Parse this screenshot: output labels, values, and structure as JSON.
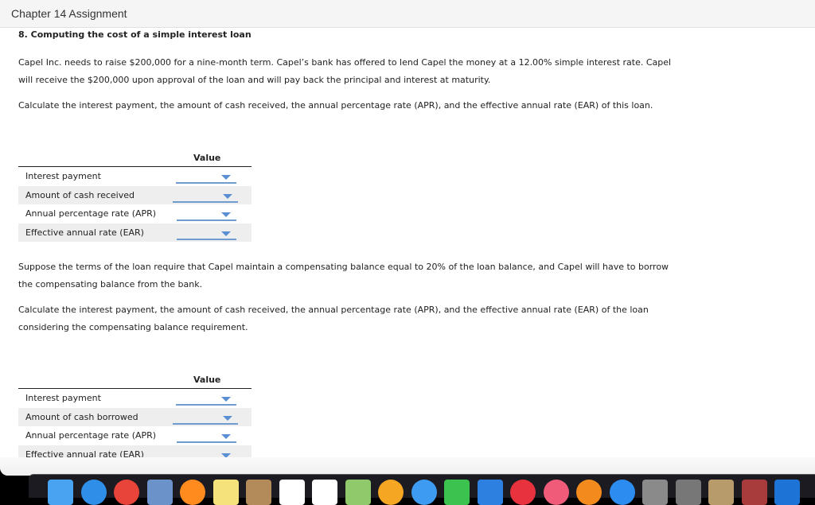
{
  "header": {
    "title": "Chapter 14 Assignment"
  },
  "question": {
    "title": "8. Computing the cost of a simple interest loan",
    "intro_line1": "Capel Inc. needs to raise $200,000 for a nine-month term. Capel’s bank has offered to lend Capel the money at a 12.00% simple interest rate. Capel",
    "intro_line2": "will receive the $200,000 upon approval of the loan and will pay back the principal and interest at maturity.",
    "instruction1": "Calculate the interest payment, the amount of cash received, the annual percentage rate (APR), and the effective annual rate (EAR) of this loan.",
    "scenario_line1": "Suppose the terms of the loan require that Capel maintain a compensating balance equal to 20% of the loan balance, and Capel will have to borrow",
    "scenario_line2": "the compensating balance from the bank.",
    "instruction2_line1": "Calculate the interest payment, the amount of cash received, the annual percentage rate (APR), and the effective annual rate (EAR) of the loan",
    "instruction2_line2": "considering the compensating balance requirement."
  },
  "table1": {
    "header": "Value",
    "rows": [
      {
        "label": "Interest payment",
        "value": ""
      },
      {
        "label": "Amount of cash received",
        "value": ""
      },
      {
        "label": "Annual percentage rate (APR)",
        "value": ""
      },
      {
        "label": "Effective annual rate (EAR)",
        "value": ""
      }
    ]
  },
  "table2": {
    "header": "Value",
    "rows": [
      {
        "label": "Interest payment",
        "value": ""
      },
      {
        "label": "Amount of cash borrowed",
        "value": ""
      },
      {
        "label": "Annual percentage rate (APR)",
        "value": ""
      },
      {
        "label": "Effective annual rate (EAR)",
        "value": ""
      }
    ]
  },
  "dock": {
    "apps": [
      {
        "name": "finder-icon",
        "color": "#4aa3f0"
      },
      {
        "name": "safari-icon",
        "color": "#2f8ee8"
      },
      {
        "name": "chrome-icon",
        "color": "#e8443a"
      },
      {
        "name": "preview-stamp-icon",
        "color": "#6c93c9"
      },
      {
        "name": "firefox-icon",
        "color": "#ff8b1f"
      },
      {
        "name": "notes-icon",
        "color": "#f6e27a"
      },
      {
        "name": "contacts-icon",
        "color": "#b38a5a"
      },
      {
        "name": "calendar-icon",
        "color": "#ffffff"
      },
      {
        "name": "reminders-icon",
        "color": "#ffffff"
      },
      {
        "name": "maps-icon",
        "color": "#8fc96b"
      },
      {
        "name": "photos-icon",
        "color": "#f5a623"
      },
      {
        "name": "messages-icon",
        "color": "#3e9bf2"
      },
      {
        "name": "facetime-icon",
        "color": "#3cc24e"
      },
      {
        "name": "keynote-icon",
        "color": "#2d7fe0"
      },
      {
        "name": "news-icon",
        "color": "#e8333e"
      },
      {
        "name": "music-icon",
        "color": "#f05b7a"
      },
      {
        "name": "books-icon",
        "color": "#f28a1e"
      },
      {
        "name": "app-store-icon",
        "color": "#2d8cf0"
      },
      {
        "name": "system-preferences-icon",
        "color": "#8a8a8a"
      },
      {
        "name": "calculator-icon",
        "color": "#777777"
      },
      {
        "name": "preview-icon",
        "color": "#b89b6a"
      },
      {
        "name": "dictionary-icon",
        "color": "#a83b3b"
      },
      {
        "name": "outlook-icon",
        "color": "#1e73d6"
      }
    ]
  }
}
